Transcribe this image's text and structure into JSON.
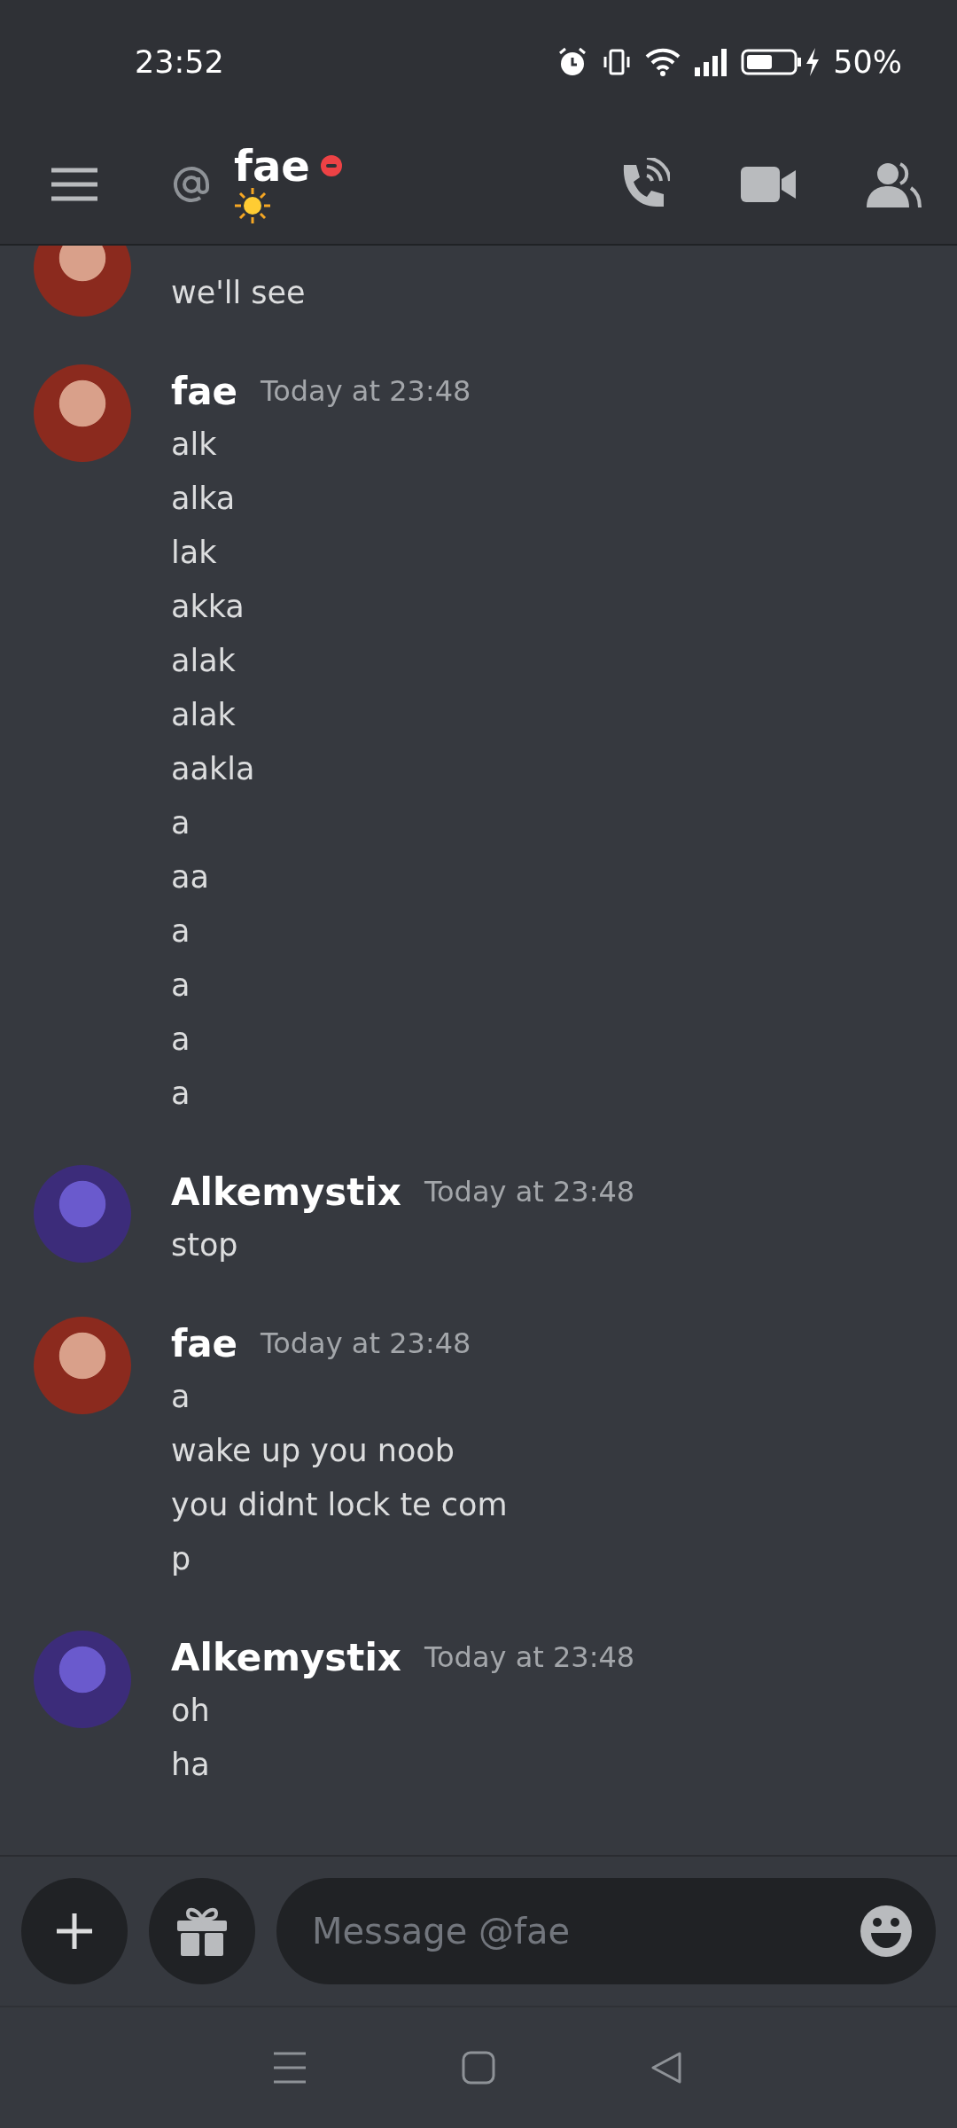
{
  "status_bar": {
    "time": "23:52",
    "battery": "50%"
  },
  "header": {
    "channel": "fae",
    "do_not_disturb": true
  },
  "messages": [
    {
      "kind": "red-hair",
      "lines": [
        "we'll see"
      ]
    },
    {
      "author": "fae",
      "timestamp": "Today at 23:48",
      "kind": "red-hair",
      "lines": [
        "alk",
        "alka",
        "lak",
        "akka",
        "alak",
        "alak",
        "aakla",
        "a",
        "aa",
        "a",
        "a",
        "a",
        "a"
      ]
    },
    {
      "author": "Alkemystix",
      "timestamp": "Today at 23:48",
      "kind": "purple",
      "lines": [
        "stop"
      ]
    },
    {
      "author": "fae",
      "timestamp": "Today at 23:48",
      "kind": "red-hair",
      "lines": [
        "a",
        "wake up you noob",
        "you didnt lock te com",
        "p"
      ]
    },
    {
      "author": "Alkemystix",
      "timestamp": "Today at 23:48",
      "kind": "purple",
      "lines": [
        "oh",
        "ha"
      ]
    }
  ],
  "composer": {
    "placeholder": "Message @fae"
  }
}
